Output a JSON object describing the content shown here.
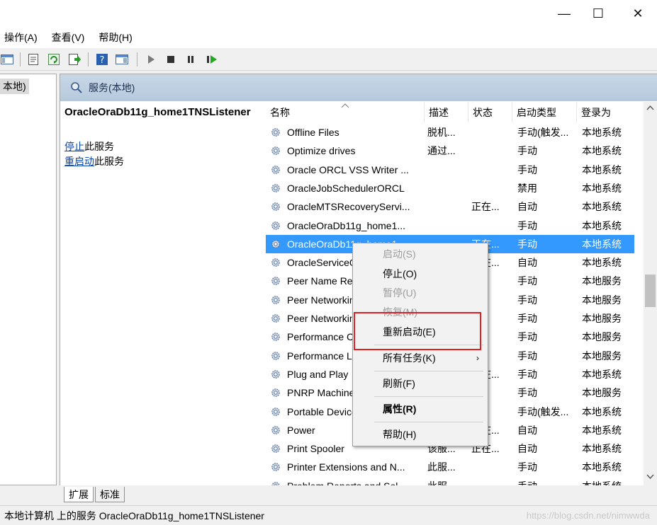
{
  "window": {
    "minimize": "—",
    "maximize": "☐",
    "close": "✕"
  },
  "menu": {
    "action": "操作(A)",
    "view": "查看(V)",
    "help": "帮助(H)"
  },
  "tree": {
    "selected": "本地)"
  },
  "panel": {
    "header": "服务(本地)",
    "service_name": "OracleOraDb11g_home1TNSListener",
    "stop_link": "停止",
    "stop_suffix": "此服务",
    "restart_link": "重启动",
    "restart_suffix": "此服务"
  },
  "table": {
    "columns": [
      "名称",
      "描述",
      "状态",
      "启动类型",
      "登录为"
    ],
    "rows": [
      {
        "name": "Offline Files",
        "desc": "脱机...",
        "status": "",
        "start": "手动(触发...",
        "logon": "本地系统"
      },
      {
        "name": "Optimize drives",
        "desc": "通过...",
        "status": "",
        "start": "手动",
        "logon": "本地系统"
      },
      {
        "name": "Oracle ORCL VSS Writer ...",
        "desc": "",
        "status": "",
        "start": "手动",
        "logon": "本地系统"
      },
      {
        "name": "OracleJobSchedulerORCL",
        "desc": "",
        "status": "",
        "start": "禁用",
        "logon": "本地系统"
      },
      {
        "name": "OracleMTSRecoveryServi...",
        "desc": "",
        "status": "正在...",
        "start": "自动",
        "logon": "本地系统"
      },
      {
        "name": "OracleOraDb11g_home1...",
        "desc": "",
        "status": "",
        "start": "手动",
        "logon": "本地系统"
      },
      {
        "name": "OracleOraDb11g_home1...",
        "desc": "",
        "status": "正在...",
        "start": "手动",
        "logon": "本地系统"
      },
      {
        "name": "OracleServiceORCL",
        "desc": "",
        "status": "正在...",
        "start": "自动",
        "logon": "本地系统"
      },
      {
        "name": "Peer Name Resolution P...",
        "desc": "",
        "status": "",
        "start": "手动",
        "logon": "本地服务"
      },
      {
        "name": "Peer Networking Group...",
        "desc": "",
        "status": "",
        "start": "手动",
        "logon": "本地服务"
      },
      {
        "name": "Peer Networking Identi...",
        "desc": "",
        "status": "",
        "start": "手动",
        "logon": "本地服务"
      },
      {
        "name": "Performance Counter DL...",
        "desc": "",
        "status": "",
        "start": "手动",
        "logon": "本地服务"
      },
      {
        "name": "Performance Logs & Aler...",
        "desc": "",
        "status": "",
        "start": "手动",
        "logon": "本地服务"
      },
      {
        "name": "Plug and Play",
        "desc": "",
        "status": "正在...",
        "start": "手动",
        "logon": "本地系统"
      },
      {
        "name": "PNRP Machine Name Pu...",
        "desc": "",
        "status": "",
        "start": "手动",
        "logon": "本地服务"
      },
      {
        "name": "Portable Device Enumer...",
        "desc": "",
        "status": "",
        "start": "手动(触发...",
        "logon": "本地系统"
      },
      {
        "name": "Power",
        "desc": "",
        "status": "正在...",
        "start": "自动",
        "logon": "本地系统"
      },
      {
        "name": "Print Spooler",
        "desc": "该服...",
        "status": "正在...",
        "start": "自动",
        "logon": "本地系统"
      },
      {
        "name": "Printer Extensions and N...",
        "desc": "此服...",
        "status": "",
        "start": "手动",
        "logon": "本地系统"
      },
      {
        "name": "Problem Reports and Sol...",
        "desc": "此服...",
        "status": "",
        "start": "手动",
        "logon": "本地系统"
      }
    ]
  },
  "context_menu": {
    "start": "启动(S)",
    "stop": "停止(O)",
    "pause": "暂停(U)",
    "resume": "恢复(M)",
    "restart": "重新启动(E)",
    "all_tasks": "所有任务(K)",
    "refresh": "刷新(F)",
    "properties": "属性(R)",
    "help": "帮助(H)"
  },
  "tabs": {
    "extended": "扩展",
    "standard": "标准"
  },
  "status": {
    "text": "本地计算机 上的服务 OracleOraDb11g_home1TNSListener",
    "watermark": "https://blog.csdn.net/nimwwda"
  },
  "colors": {
    "selection": "#3399ff",
    "highlight_box": "#e02020",
    "header_band": "#c7d7e6"
  }
}
